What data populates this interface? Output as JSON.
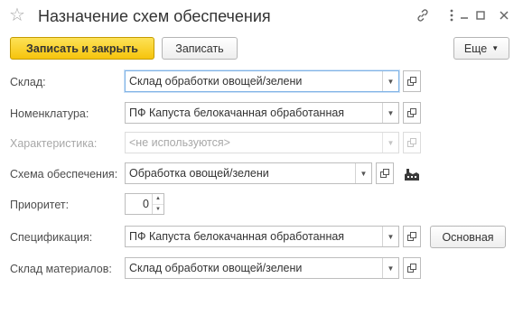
{
  "window": {
    "title": "Назначение схем обеспечения",
    "icons": [
      "star-icon",
      "link-icon",
      "more-vertical-icon",
      "minimize-icon",
      "maximize-icon",
      "close-icon"
    ]
  },
  "toolbar": {
    "save_close_label": "Записать и закрыть",
    "save_label": "Записать",
    "more_label": "Еще",
    "more_icon": "dropdown-arrow-icon"
  },
  "form": {
    "warehouse": {
      "label": "Склад:",
      "value": "Склад обработки овощей/зелени"
    },
    "nomenclature": {
      "label": "Номенклатура:",
      "value": "ПФ Капуста белокачанная обработанная"
    },
    "characteristic": {
      "label": "Характеристика:",
      "placeholder": "<не используются>",
      "disabled": true
    },
    "scheme": {
      "label": "Схема обеспечения:",
      "value": "Обработка овощей/зелени",
      "extra_icon": "factory-icon"
    },
    "priority": {
      "label": "Приоритет:",
      "value": "0"
    },
    "specification": {
      "label": "Спецификация:",
      "value": "ПФ Капуста белокачанная обработанная",
      "action_label": "Основная"
    },
    "materials_warehouse": {
      "label": "Склад материалов:",
      "value": "Склад обработки овощей/зелени"
    }
  },
  "colors": {
    "primary_button": "#f6c40c",
    "focus_border": "#7fb3e6",
    "disabled_text": "#a8a8a8"
  }
}
